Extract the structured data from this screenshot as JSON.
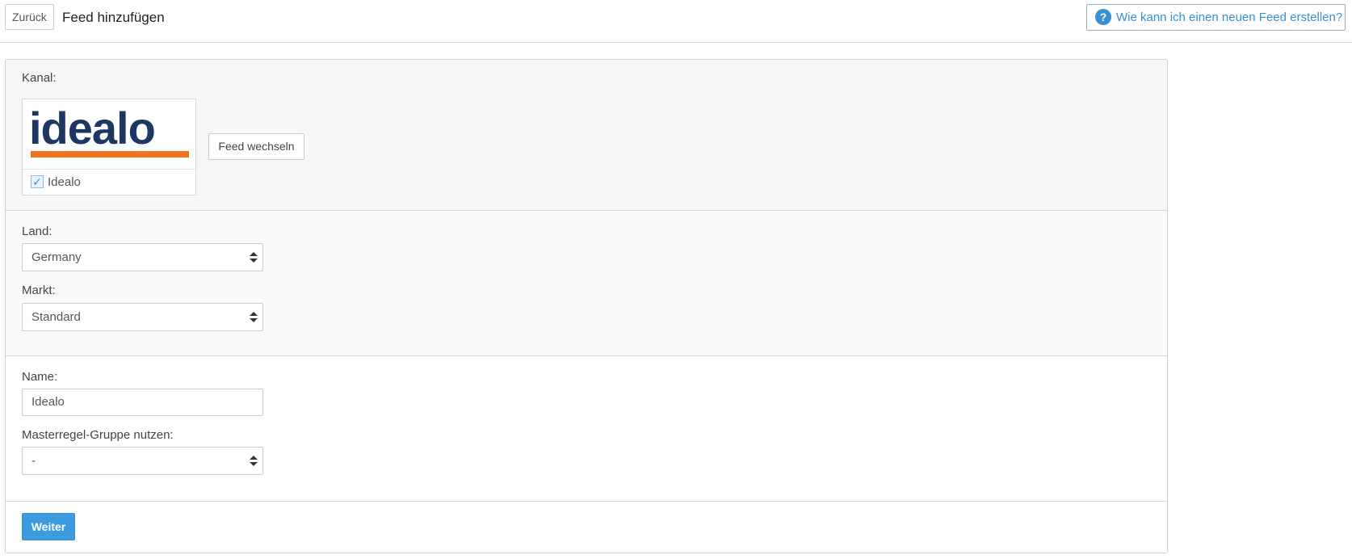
{
  "header": {
    "back_label": "Zurück",
    "title": "Feed hinzufügen",
    "help_label": "Wie kann ich einen neuen Feed erstellen?",
    "help_icon_glyph": "?"
  },
  "channel": {
    "label": "Kanal:",
    "logo_text": "idealo",
    "card_label": "Idealo",
    "checked": true,
    "check_glyph": "✓",
    "switch_label": "Feed wechseln"
  },
  "country": {
    "label": "Land:",
    "selected": "Germany"
  },
  "market": {
    "label": "Markt:",
    "selected": "Standard"
  },
  "name": {
    "label": "Name:",
    "value": "Idealo"
  },
  "master_rule": {
    "label": "Masterregel-Gruppe nutzen:",
    "selected": "-"
  },
  "actions": {
    "next_label": "Weiter"
  },
  "colors": {
    "accent": "#3d9be0",
    "logo_blue": "#1d3763",
    "logo_orange": "#f0701e"
  }
}
